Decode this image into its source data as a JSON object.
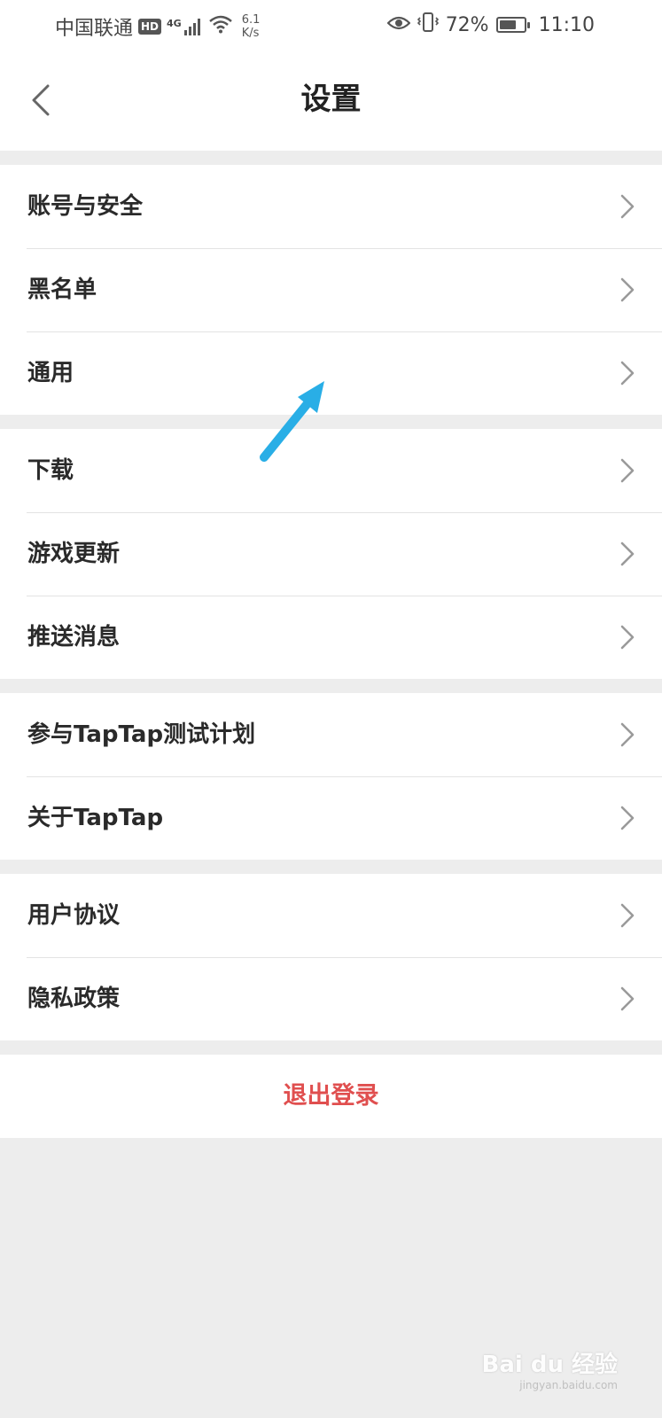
{
  "status_bar": {
    "carrier": "中国联通",
    "hd": "HD",
    "network": "4G",
    "speed_value": "6.1",
    "speed_unit": "K/s",
    "battery": "72%",
    "time": "11:10"
  },
  "header": {
    "title": "设置"
  },
  "groups": [
    {
      "items": [
        "账号与安全",
        "黑名单",
        "通用"
      ]
    },
    {
      "items": [
        "下载",
        "游戏更新",
        "推送消息"
      ]
    },
    {
      "items": [
        "参与TapTap测试计划",
        "关于TapTap"
      ]
    },
    {
      "items": [
        "用户协议",
        "隐私政策"
      ]
    }
  ],
  "logout_label": "退出登录",
  "watermark": {
    "brand": "Bai du 经验",
    "url": "jingyan.baidu.com"
  },
  "colors": {
    "logout": "#e04f4f",
    "annotation_arrow": "#29aee6",
    "background": "#ededed"
  },
  "battery_level": 0.72
}
